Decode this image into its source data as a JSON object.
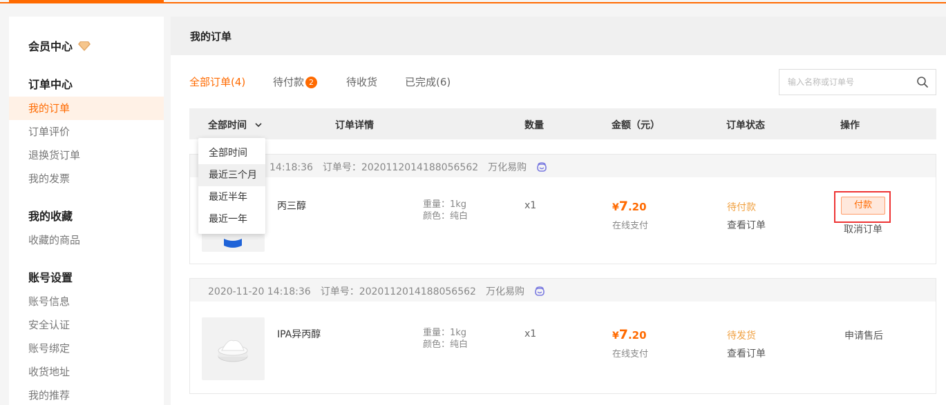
{
  "sidebar": {
    "member_center": "会员中心",
    "sections": [
      {
        "title": "订单中心",
        "items": [
          "我的订单",
          "订单评价",
          "退换货订单",
          "我的发票"
        ]
      },
      {
        "title": "我的收藏",
        "items": [
          "收藏的商品"
        ]
      },
      {
        "title": "账号设置",
        "items": [
          "账号信息",
          "安全认证",
          "账号绑定",
          "收货地址",
          "我的推荐"
        ]
      }
    ]
  },
  "main": {
    "title": "我的订单",
    "tabs": [
      {
        "label": "全部订单(4)"
      },
      {
        "label": "待付款",
        "badge": "2"
      },
      {
        "label": "待收货"
      },
      {
        "label": "已完成(6)"
      }
    ],
    "search": {
      "placeholder": "输入名称或订单号",
      "icon": "search-icon"
    },
    "table_headers": {
      "time_filter": "全部时间",
      "detail": "订单详情",
      "qty": "数量",
      "amount": "金额（元）",
      "status": "订单状态",
      "action": "操作"
    },
    "time_dropdown": [
      "全部时间",
      "最近三个月",
      "最近半年",
      "最近一年"
    ],
    "orders": [
      {
        "time": "14:18:36",
        "order_no_label": "订单号：",
        "order_no": "2020112014188056562",
        "shop": "万化易购",
        "product": "丙三醇",
        "weight": "重量：1kg",
        "color": "颜色：纯白",
        "qty": "x1",
        "currency": "¥",
        "price_int": "7",
        "price_dec": ".20",
        "pay_method": "在线支付",
        "status": "待付款",
        "view": "查看订单",
        "pay_button": "付款",
        "cancel": "取消订单"
      },
      {
        "time": "2020-11-20 14:18:36",
        "order_no_label": "订单号：",
        "order_no": "2020112014188056562",
        "shop": "万化易购",
        "product": "IPA异丙醇",
        "weight": "重量：1kg",
        "color": "颜色：纯白",
        "qty": "x1",
        "currency": "¥",
        "price_int": "7",
        "price_dec": ".20",
        "pay_method": "在线支付",
        "status": "待发货",
        "view": "查看订单",
        "action": "申请售后"
      }
    ]
  },
  "colors": {
    "accent": "#ff6a00",
    "status_pending": "#f0a040",
    "highlight_frame": "#e33333"
  }
}
